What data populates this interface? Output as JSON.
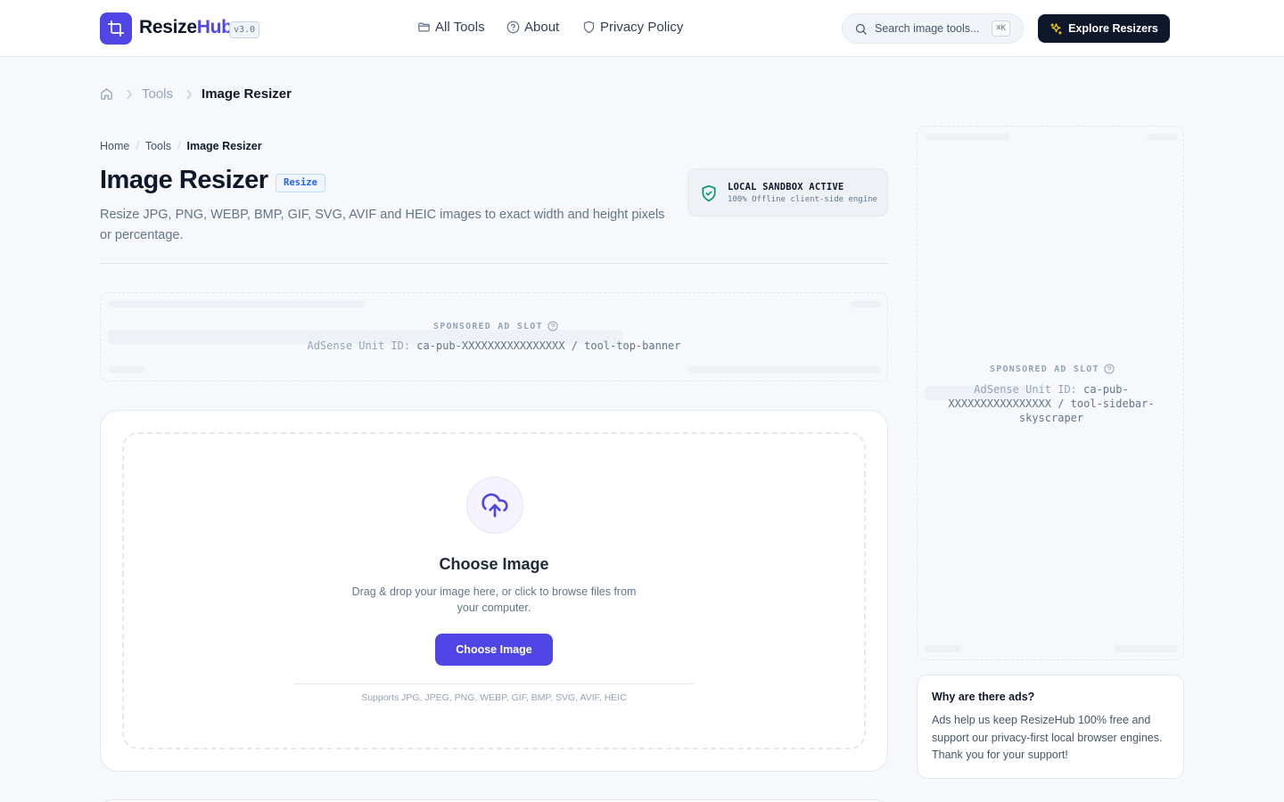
{
  "header": {
    "brand_part1": "Resize",
    "brand_part2": "Hub",
    "version": "v3.0",
    "nav": [
      {
        "label": "All Tools",
        "icon": "folder-icon"
      },
      {
        "label": "About",
        "icon": "help-circle-icon"
      },
      {
        "label": "Privacy Policy",
        "icon": "shield-icon"
      }
    ],
    "search_placeholder": "Search image tools...",
    "search_shortcut": "⌘K",
    "cta_label": "Explore Resizers",
    "brand_color": "#4f46e5"
  },
  "breadcrumb_top": [
    "Tools",
    "Image Resizer"
  ],
  "breadcrumb_small": [
    "Home",
    "Tools",
    "Image Resizer"
  ],
  "page": {
    "title": "Image Resizer",
    "tag": "Resize",
    "description": "Resize JPG, PNG, WEBP, BMP, GIF, SVG, AVIF and HEIC images to exact width and height pixels or percentage."
  },
  "sandbox": {
    "title": "LOCAL SANDBOX ACTIVE",
    "subtitle": "100% Offline client-side engine",
    "accent": "#059669"
  },
  "ads": {
    "label": "SPONSORED AD SLOT",
    "id_prefix": "AdSense Unit ID:",
    "top_unit": "ca-pub-XXXXXXXXXXXXXXXX / tool-top-banner",
    "sidebar_unit": "ca-pub-XXXXXXXXXXXXXXXX / tool-sidebar-skyscraper"
  },
  "upload": {
    "title": "Choose Image",
    "description": "Drag & drop your image here, or click to browse files from your computer.",
    "button": "Choose Image",
    "supports": "Supports JPG, JPEG, PNG, WEBP, GIF, BMP, SVG, AVIF, HEIC"
  },
  "why_ads": {
    "title": "Why are there ads?",
    "body": "Ads help us keep ResizeHub 100% free and support our privacy-first local browser engines. Thank you for your support!"
  }
}
